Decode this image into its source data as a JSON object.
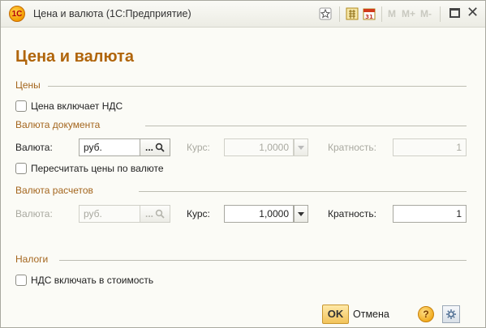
{
  "window": {
    "title": "Цена и валюта  (1С:Предприятие)",
    "toolbar_m": [
      "M",
      "M+",
      "M-"
    ]
  },
  "form": {
    "title": "Цена и валюта"
  },
  "prices": {
    "group_label": "Цены",
    "vat_included_label": "Цена включает НДС",
    "vat_included_checked": false
  },
  "doc_currency": {
    "group_label": "Валюта документа",
    "currency_label": "Валюта:",
    "currency_value": "руб.",
    "select_label": "...",
    "rate_label": "Курс:",
    "rate_value": "1,0000",
    "multiplicity_label": "Кратность:",
    "multiplicity_value": "1",
    "recalc_label": "Пересчитать цены по валюте",
    "recalc_checked": false
  },
  "settle_currency": {
    "group_label": "Валюта расчетов",
    "currency_label": "Валюта:",
    "currency_value": "руб.",
    "select_label": "...",
    "rate_label": "Курс:",
    "rate_value": "1,0000",
    "multiplicity_label": "Кратность:",
    "multiplicity_value": "1"
  },
  "taxes": {
    "group_label": "Налоги",
    "vat_in_cost_label": "НДС включать в стоимость",
    "vat_in_cost_checked": false
  },
  "footer": {
    "ok_label": "OK",
    "cancel_label": "Отмена",
    "help_label": "?"
  },
  "colors": {
    "accent": "#b0650b",
    "group_label": "#a4661e"
  }
}
